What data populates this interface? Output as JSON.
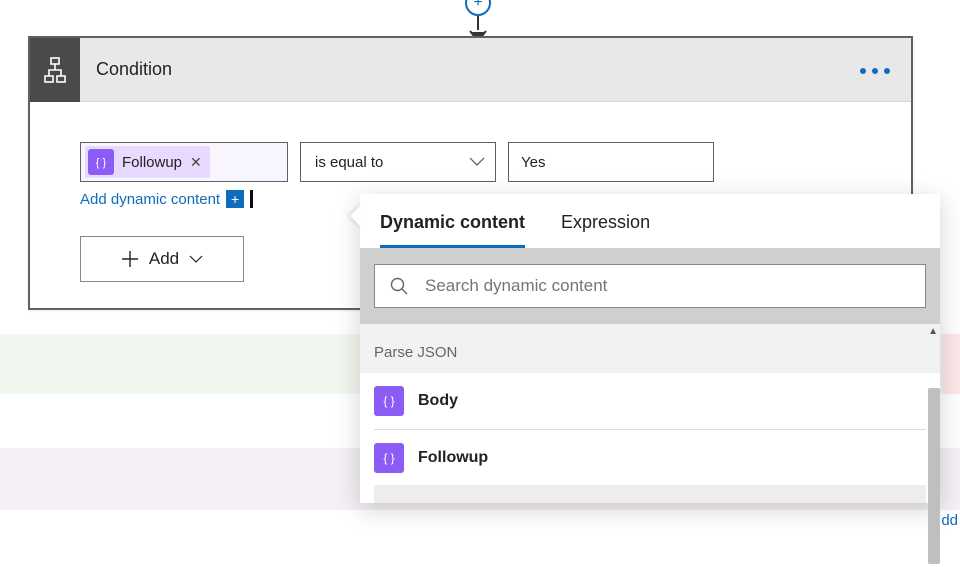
{
  "card": {
    "title": "Condition",
    "row": {
      "first_token_label": "Followup",
      "operator_label": "is equal to",
      "value_text": "Yes"
    },
    "sublink_label": "Add dynamic content",
    "add_button_label": "Add"
  },
  "popover": {
    "tabs": {
      "dynamic": "Dynamic content",
      "expression": "Expression"
    },
    "search_placeholder": "Search dynamic content",
    "section_title": "Parse JSON",
    "items": [
      {
        "label": "Body"
      },
      {
        "label": "Followup"
      }
    ]
  },
  "fragment_text": "dd"
}
